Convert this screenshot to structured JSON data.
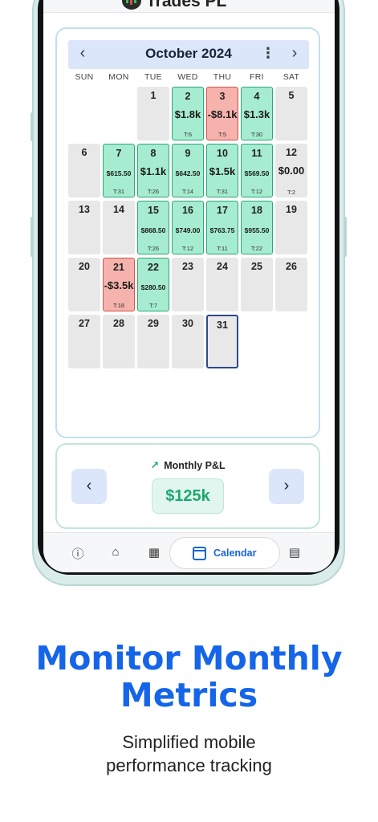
{
  "app": {
    "title": "Trades PL"
  },
  "calendar": {
    "month_label": "October 2024",
    "prev_label": "‹",
    "next_label": "›",
    "more_label": "⋮",
    "weekdays": [
      "SUN",
      "MON",
      "TUE",
      "WED",
      "THU",
      "FRI",
      "SAT"
    ],
    "days": [
      {
        "day": "1"
      },
      {
        "day": "2",
        "pnl": "$1.8k",
        "trades": "T:6",
        "status": "win"
      },
      {
        "day": "3",
        "pnl": "-$8.1k",
        "trades": "T:5",
        "status": "loss"
      },
      {
        "day": "4",
        "pnl": "$1.3k",
        "trades": "T:30",
        "status": "win"
      },
      {
        "day": "5"
      },
      {
        "day": "6"
      },
      {
        "day": "7",
        "pnl": "$615.50",
        "trades": "T:31",
        "status": "win"
      },
      {
        "day": "8",
        "pnl": "$1.1k",
        "trades": "T:26",
        "status": "win"
      },
      {
        "day": "9",
        "pnl": "$642.50",
        "trades": "T:14",
        "status": "win"
      },
      {
        "day": "10",
        "pnl": "$1.5k",
        "trades": "T:31",
        "status": "win"
      },
      {
        "day": "11",
        "pnl": "$569.50",
        "trades": "T:12",
        "status": "win"
      },
      {
        "day": "12",
        "pnl": "$0.00",
        "trades": "T:2",
        "status": "neutral"
      },
      {
        "day": "13"
      },
      {
        "day": "14"
      },
      {
        "day": "15",
        "pnl": "$868.50",
        "trades": "T:26",
        "status": "win"
      },
      {
        "day": "16",
        "pnl": "$749.00",
        "trades": "T:12",
        "status": "win"
      },
      {
        "day": "17",
        "pnl": "$763.75",
        "trades": "T:11",
        "status": "win"
      },
      {
        "day": "18",
        "pnl": "$955.50",
        "trades": "T:22",
        "status": "win"
      },
      {
        "day": "19"
      },
      {
        "day": "20"
      },
      {
        "day": "21",
        "pnl": "-$3.5k",
        "trades": "T:18",
        "status": "loss"
      },
      {
        "day": "22",
        "pnl": "$280.50",
        "trades": "T:7",
        "status": "win"
      },
      {
        "day": "23"
      },
      {
        "day": "24"
      },
      {
        "day": "25"
      },
      {
        "day": "26"
      },
      {
        "day": "27"
      },
      {
        "day": "28"
      },
      {
        "day": "29"
      },
      {
        "day": "30"
      },
      {
        "day": "31",
        "status": "today"
      }
    ]
  },
  "monthly_pl": {
    "label": "Monthly P&L",
    "value": "$125k",
    "prev_label": "‹",
    "next_label": "›"
  },
  "bottom_nav": {
    "active_label": "Calendar",
    "items": [
      "info-icon",
      "home-icon",
      "calculator-icon",
      "calendar-icon",
      "table-icon"
    ]
  },
  "marketing": {
    "headline_line1": "Monitor Monthly",
    "headline_line2": "Metrics",
    "sub_line1": "Simplified mobile",
    "sub_line2": "performance tracking"
  },
  "colors": {
    "accent_blue": "#1565e8",
    "win_green": "#a6ecd0",
    "loss_red": "#f6b3ad",
    "pnl_green": "#1ea872"
  }
}
